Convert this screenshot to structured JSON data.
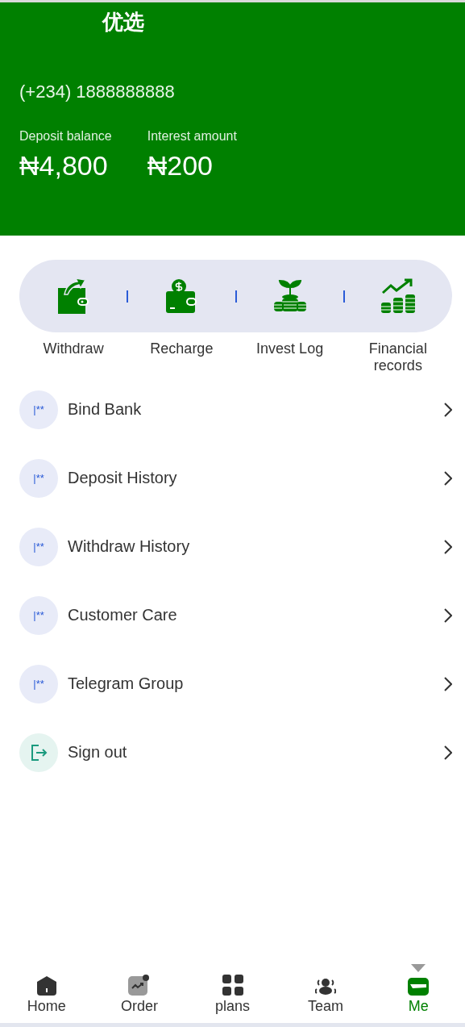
{
  "header": {
    "title": "优选",
    "phone": "(+234) 1888888888",
    "stats": [
      {
        "label": "Deposit balance",
        "value": "₦4,800"
      },
      {
        "label": "Interest amount",
        "value": "₦200"
      }
    ]
  },
  "actions": [
    {
      "kind": "withdraw",
      "label": "Withdraw"
    },
    {
      "kind": "recharge",
      "label": "Recharge"
    },
    {
      "kind": "invest",
      "label": "Invest Log"
    },
    {
      "kind": "records",
      "label": "Financial records"
    }
  ],
  "menu": [
    {
      "kind": "glyph",
      "glyph": "|**",
      "label": "Bind Bank"
    },
    {
      "kind": "glyph",
      "glyph": "|**",
      "label": "Deposit History"
    },
    {
      "kind": "glyph",
      "glyph": "|**",
      "label": "Withdraw History"
    },
    {
      "kind": "glyph",
      "glyph": "|**",
      "label": "Customer Care"
    },
    {
      "kind": "glyph",
      "glyph": "|**",
      "label": "Telegram Group"
    },
    {
      "kind": "signout",
      "label": "Sign out"
    }
  ],
  "tabbar": [
    {
      "kind": "home",
      "label": "Home",
      "selected": false
    },
    {
      "kind": "order",
      "label": "Order",
      "selected": false
    },
    {
      "kind": "plans",
      "label": "plans",
      "selected": false
    },
    {
      "kind": "team",
      "label": "Team",
      "selected": false
    },
    {
      "kind": "me",
      "label": "Me",
      "selected": true
    }
  ]
}
